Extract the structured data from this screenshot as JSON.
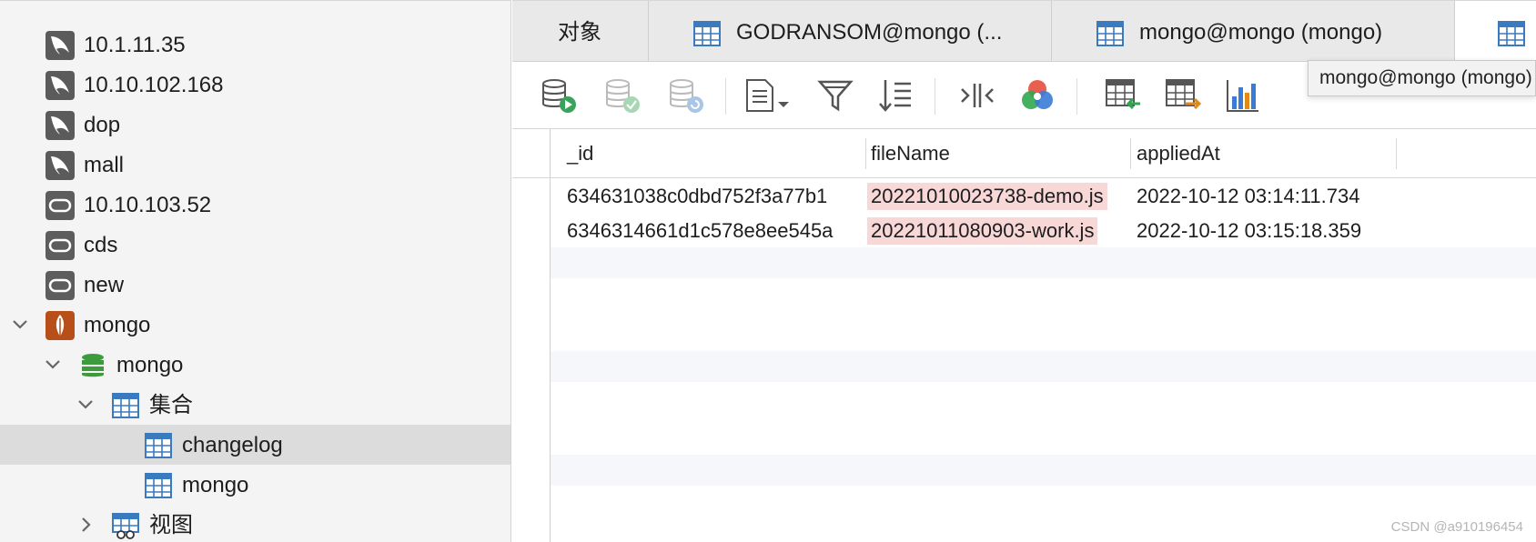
{
  "sidebar": {
    "items": [
      {
        "label": "10.1.11.35",
        "icon": "mysql-icon"
      },
      {
        "label": "10.10.102.168",
        "icon": "mysql-icon"
      },
      {
        "label": "dop",
        "icon": "mysql-icon"
      },
      {
        "label": "mall",
        "icon": "mysql-icon"
      },
      {
        "label": "10.10.103.52",
        "icon": "oracle-icon"
      },
      {
        "label": "cds",
        "icon": "oracle-icon"
      },
      {
        "label": "new",
        "icon": "oracle-icon"
      },
      {
        "label": "mongo",
        "icon": "mongodb-icon",
        "expanded": true
      },
      {
        "label": "mongo",
        "icon": "database-icon",
        "expanded": true
      },
      {
        "label": "集合",
        "icon": "table-icon",
        "expanded": true
      },
      {
        "label": "changelog",
        "icon": "table-icon",
        "selected": true
      },
      {
        "label": "mongo",
        "icon": "table-icon"
      },
      {
        "label": "视图",
        "icon": "view-icon",
        "expanded": false
      }
    ]
  },
  "tabs": [
    {
      "label": "对象",
      "active": false
    },
    {
      "label": "GODRANSOM@mongo (...",
      "active": false
    },
    {
      "label": "mongo@mongo (mongo)",
      "active": false
    },
    {
      "label": "",
      "active": true
    }
  ],
  "tooltip": {
    "text": "mongo@mongo (mongo)"
  },
  "toolbar": {
    "buttons": [
      "run-query-icon",
      "apply-icon",
      "refresh-icon",
      "document-menu-icon",
      "filter-icon",
      "sort-icon",
      "split-view-icon",
      "color-wheel-icon",
      "import-table-icon",
      "export-table-icon",
      "chart-icon"
    ]
  },
  "grid": {
    "columns": [
      "_id",
      "fileName",
      "appliedAt"
    ],
    "rows": [
      [
        "634631038c0dbd752f3a77b1",
        "20221010023738-demo.js",
        "2022-10-12 03:14:11.734"
      ],
      [
        "6346314661d1c578e8ee545a",
        "20221011080903-work.js",
        "2022-10-12 03:15:18.359"
      ]
    ]
  },
  "watermark": "CSDN @a910196454",
  "colors": {
    "accent_table": "#3a7abf",
    "highlight": "#f8d7d7",
    "mongo_brand": "#b94f18",
    "db_green": "#3d9a3d"
  }
}
